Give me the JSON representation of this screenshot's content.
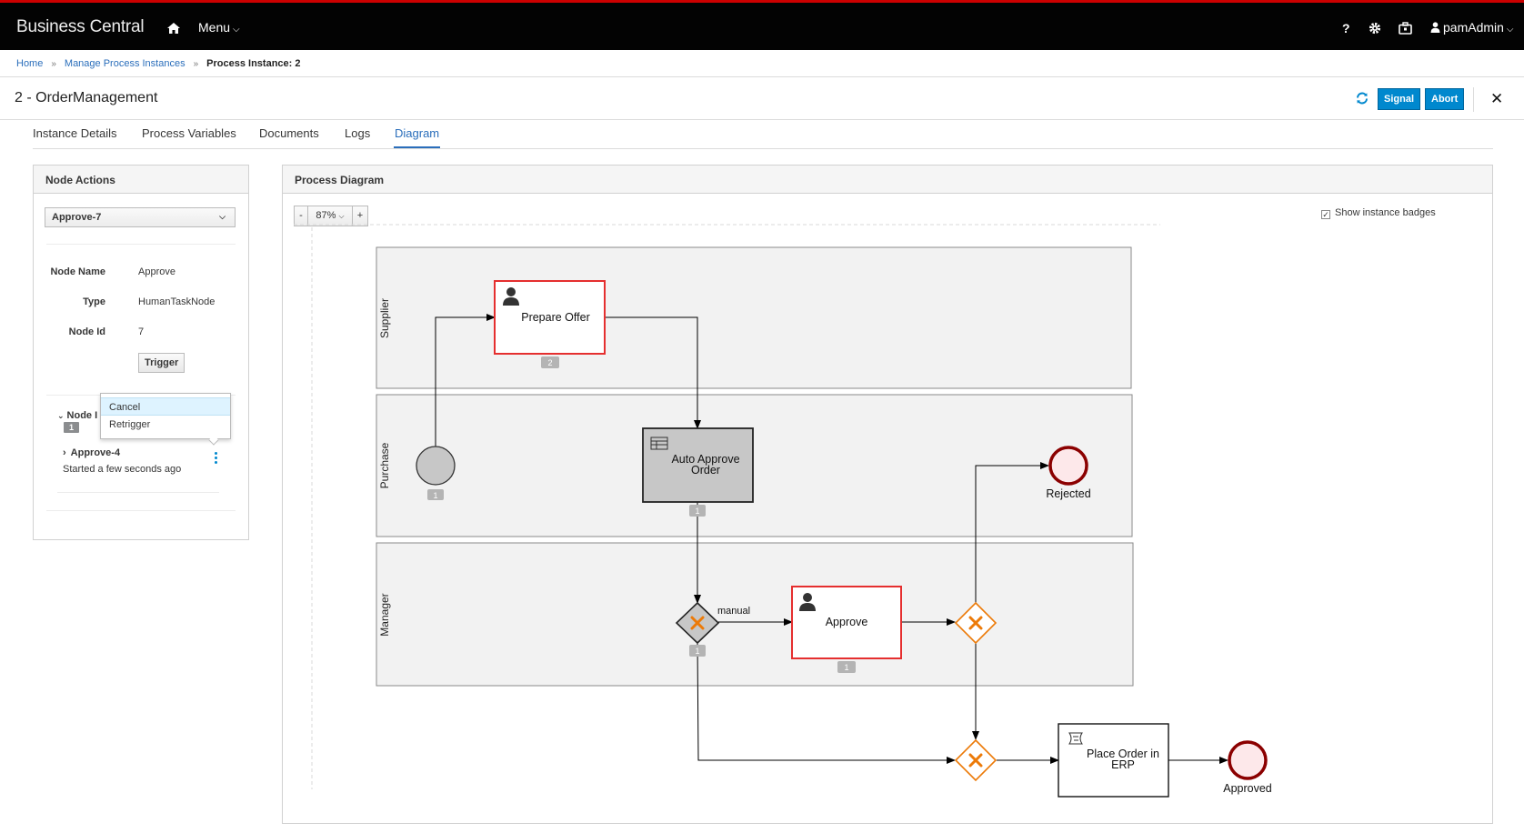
{
  "app": {
    "brand": "Business Central",
    "menu_label": "Menu",
    "user": "pamAdmin",
    "help": "?"
  },
  "breadcrumb": {
    "home": "Home",
    "manage": "Manage Process Instances",
    "current": "Process Instance: 2"
  },
  "page": {
    "title": "2 - OrderManagement",
    "signal_label": "Signal",
    "abort_label": "Abort"
  },
  "tabs": [
    "Instance Details",
    "Process Variables",
    "Documents",
    "Logs",
    "Diagram"
  ],
  "active_tab": "Diagram",
  "node_actions": {
    "title": "Node Actions",
    "selected_node": "Approve-7",
    "node_name_label": "Node Name",
    "node_name": "Approve",
    "type_label": "Type",
    "type": "HumanTaskNode",
    "node_id_label": "Node Id",
    "node_id": "7",
    "trigger_label": "Trigger",
    "instances_label": "Node I",
    "instances_count": "1",
    "instance_item": "Approve-4",
    "instance_started": "Started a few seconds ago",
    "menu_items": [
      "Cancel",
      "Retrigger"
    ]
  },
  "diagram": {
    "title": "Process Diagram",
    "zoom_minus": "-",
    "zoom_level": "87%",
    "zoom_plus": "+",
    "show_badges_label": "Show instance badges",
    "lanes": [
      "Supplier",
      "Purchase",
      "Manager"
    ],
    "prepare_offer": "Prepare Offer",
    "prepare_offer_badge": "2",
    "start_badge": "1",
    "auto_approve_line1": "Auto Approve",
    "auto_approve_line2": "Order",
    "auto_badge": "1",
    "gateway_badge": "1",
    "manual_label": "manual",
    "approve": "Approve",
    "approve_badge": "1",
    "rejected": "Rejected",
    "place_order_line1": "Place Order in",
    "place_order_line2": "ERP",
    "approved": "Approved"
  },
  "colors": {
    "accent": "#0088ce",
    "active_node": "#e52f2f",
    "gateway": "#ec7a08",
    "end_event": "#8b0000"
  }
}
